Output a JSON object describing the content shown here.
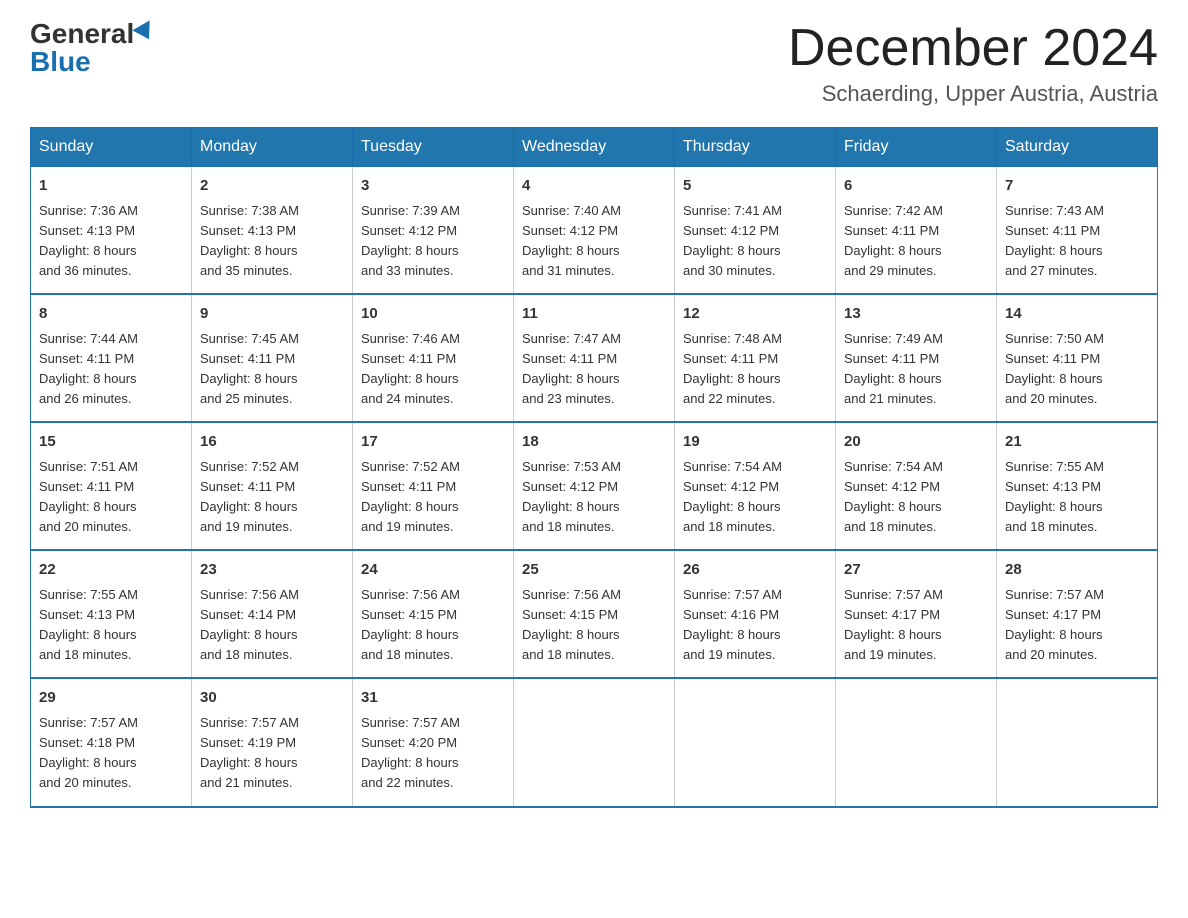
{
  "header": {
    "logo_general": "General",
    "logo_blue": "Blue",
    "month_title": "December 2024",
    "location": "Schaerding, Upper Austria, Austria"
  },
  "days_of_week": [
    "Sunday",
    "Monday",
    "Tuesday",
    "Wednesday",
    "Thursday",
    "Friday",
    "Saturday"
  ],
  "weeks": [
    [
      {
        "num": "1",
        "sunrise": "7:36 AM",
        "sunset": "4:13 PM",
        "daylight": "8 hours and 36 minutes."
      },
      {
        "num": "2",
        "sunrise": "7:38 AM",
        "sunset": "4:13 PM",
        "daylight": "8 hours and 35 minutes."
      },
      {
        "num": "3",
        "sunrise": "7:39 AM",
        "sunset": "4:12 PM",
        "daylight": "8 hours and 33 minutes."
      },
      {
        "num": "4",
        "sunrise": "7:40 AM",
        "sunset": "4:12 PM",
        "daylight": "8 hours and 31 minutes."
      },
      {
        "num": "5",
        "sunrise": "7:41 AM",
        "sunset": "4:12 PM",
        "daylight": "8 hours and 30 minutes."
      },
      {
        "num": "6",
        "sunrise": "7:42 AM",
        "sunset": "4:11 PM",
        "daylight": "8 hours and 29 minutes."
      },
      {
        "num": "7",
        "sunrise": "7:43 AM",
        "sunset": "4:11 PM",
        "daylight": "8 hours and 27 minutes."
      }
    ],
    [
      {
        "num": "8",
        "sunrise": "7:44 AM",
        "sunset": "4:11 PM",
        "daylight": "8 hours and 26 minutes."
      },
      {
        "num": "9",
        "sunrise": "7:45 AM",
        "sunset": "4:11 PM",
        "daylight": "8 hours and 25 minutes."
      },
      {
        "num": "10",
        "sunrise": "7:46 AM",
        "sunset": "4:11 PM",
        "daylight": "8 hours and 24 minutes."
      },
      {
        "num": "11",
        "sunrise": "7:47 AM",
        "sunset": "4:11 PM",
        "daylight": "8 hours and 23 minutes."
      },
      {
        "num": "12",
        "sunrise": "7:48 AM",
        "sunset": "4:11 PM",
        "daylight": "8 hours and 22 minutes."
      },
      {
        "num": "13",
        "sunrise": "7:49 AM",
        "sunset": "4:11 PM",
        "daylight": "8 hours and 21 minutes."
      },
      {
        "num": "14",
        "sunrise": "7:50 AM",
        "sunset": "4:11 PM",
        "daylight": "8 hours and 20 minutes."
      }
    ],
    [
      {
        "num": "15",
        "sunrise": "7:51 AM",
        "sunset": "4:11 PM",
        "daylight": "8 hours and 20 minutes."
      },
      {
        "num": "16",
        "sunrise": "7:52 AM",
        "sunset": "4:11 PM",
        "daylight": "8 hours and 19 minutes."
      },
      {
        "num": "17",
        "sunrise": "7:52 AM",
        "sunset": "4:11 PM",
        "daylight": "8 hours and 19 minutes."
      },
      {
        "num": "18",
        "sunrise": "7:53 AM",
        "sunset": "4:12 PM",
        "daylight": "8 hours and 18 minutes."
      },
      {
        "num": "19",
        "sunrise": "7:54 AM",
        "sunset": "4:12 PM",
        "daylight": "8 hours and 18 minutes."
      },
      {
        "num": "20",
        "sunrise": "7:54 AM",
        "sunset": "4:12 PM",
        "daylight": "8 hours and 18 minutes."
      },
      {
        "num": "21",
        "sunrise": "7:55 AM",
        "sunset": "4:13 PM",
        "daylight": "8 hours and 18 minutes."
      }
    ],
    [
      {
        "num": "22",
        "sunrise": "7:55 AM",
        "sunset": "4:13 PM",
        "daylight": "8 hours and 18 minutes."
      },
      {
        "num": "23",
        "sunrise": "7:56 AM",
        "sunset": "4:14 PM",
        "daylight": "8 hours and 18 minutes."
      },
      {
        "num": "24",
        "sunrise": "7:56 AM",
        "sunset": "4:15 PM",
        "daylight": "8 hours and 18 minutes."
      },
      {
        "num": "25",
        "sunrise": "7:56 AM",
        "sunset": "4:15 PM",
        "daylight": "8 hours and 18 minutes."
      },
      {
        "num": "26",
        "sunrise": "7:57 AM",
        "sunset": "4:16 PM",
        "daylight": "8 hours and 19 minutes."
      },
      {
        "num": "27",
        "sunrise": "7:57 AM",
        "sunset": "4:17 PM",
        "daylight": "8 hours and 19 minutes."
      },
      {
        "num": "28",
        "sunrise": "7:57 AM",
        "sunset": "4:17 PM",
        "daylight": "8 hours and 20 minutes."
      }
    ],
    [
      {
        "num": "29",
        "sunrise": "7:57 AM",
        "sunset": "4:18 PM",
        "daylight": "8 hours and 20 minutes."
      },
      {
        "num": "30",
        "sunrise": "7:57 AM",
        "sunset": "4:19 PM",
        "daylight": "8 hours and 21 minutes."
      },
      {
        "num": "31",
        "sunrise": "7:57 AM",
        "sunset": "4:20 PM",
        "daylight": "8 hours and 22 minutes."
      },
      null,
      null,
      null,
      null
    ]
  ],
  "labels": {
    "sunrise": "Sunrise:",
    "sunset": "Sunset:",
    "daylight": "Daylight:"
  }
}
